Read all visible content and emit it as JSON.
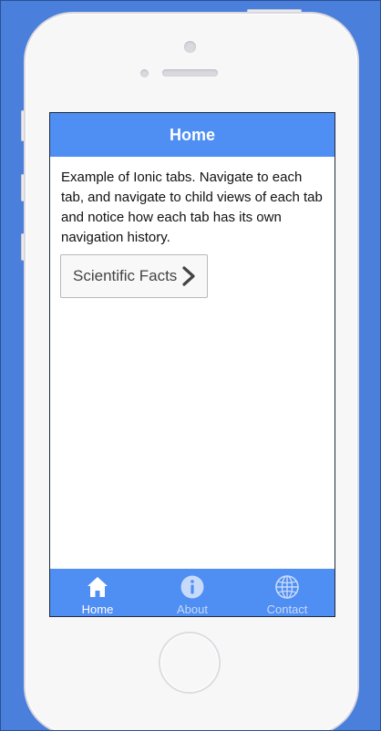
{
  "header": {
    "title": "Home"
  },
  "main": {
    "intro_text": "Example of Ionic tabs. Navigate to each tab, and navigate to child views of each tab and notice how each tab has its own navigation history.",
    "facts_button_label": "Scientific Facts"
  },
  "tabs": [
    {
      "label": "Home",
      "icon": "home-icon",
      "active": true
    },
    {
      "label": "About",
      "icon": "info-icon",
      "active": false
    },
    {
      "label": "Contact",
      "icon": "globe-icon",
      "active": false
    }
  ],
  "colors": {
    "background": "#4a7fdc",
    "bar": "#4f8ef3",
    "tab_active": "#ffffff",
    "tab_inactive": "#c8daf9"
  }
}
